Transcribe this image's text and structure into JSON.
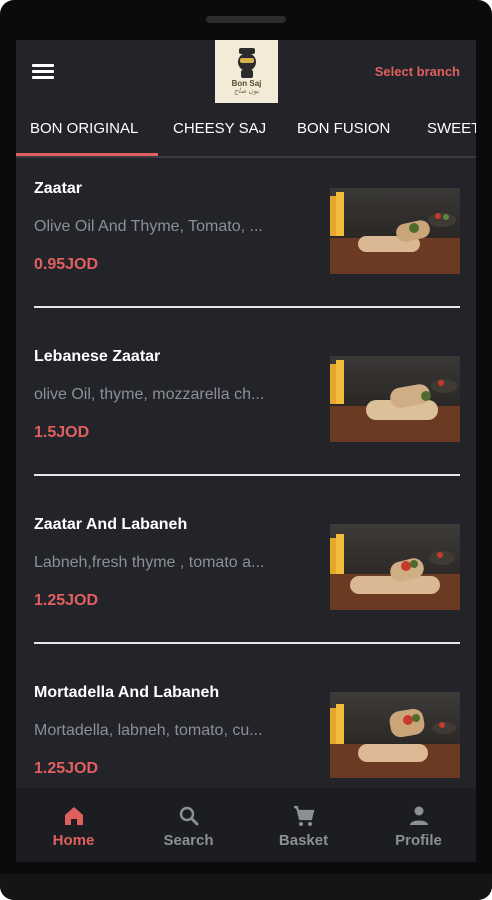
{
  "header": {
    "logo_name": "Bon Saj",
    "logo_sub": "بون صاج",
    "select_branch": "Select branch"
  },
  "tabs": [
    {
      "label": "BON ORIGINAL",
      "active": true
    },
    {
      "label": "CHEESY SAJ",
      "active": false
    },
    {
      "label": "BON FUSION",
      "active": false
    },
    {
      "label": "SWEET",
      "active": false
    }
  ],
  "items": [
    {
      "name": "Zaatar",
      "description": "Olive Oil And Thyme, Tomato, ...",
      "price": "0.95JOD"
    },
    {
      "name": "Lebanese Zaatar",
      "description": "olive Oil, thyme, mozzarella ch...",
      "price": "1.5JOD"
    },
    {
      "name": "Zaatar And Labaneh",
      "description": "Labneh,fresh thyme , tomato a...",
      "price": "1.25JOD"
    },
    {
      "name": "Mortadella And Labaneh",
      "description": "Mortadella, labneh, tomato, cu...",
      "price": "1.25JOD"
    }
  ],
  "nav": [
    {
      "label": "Home",
      "icon": "home-icon",
      "active": true
    },
    {
      "label": "Search",
      "icon": "search-icon",
      "active": false
    },
    {
      "label": "Basket",
      "icon": "cart-icon",
      "active": false
    },
    {
      "label": "Profile",
      "icon": "person-icon",
      "active": false
    }
  ],
  "colors": {
    "accent": "#e0605f",
    "background": "#23242a",
    "nav_background": "#1c1d21",
    "inactive": "#8d8f96"
  }
}
